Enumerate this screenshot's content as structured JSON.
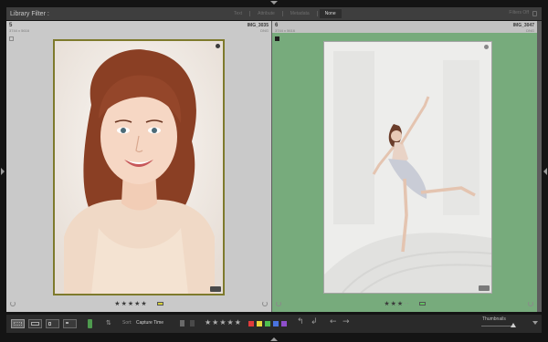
{
  "filter_bar": {
    "title": "Library Filter :",
    "tabs": [
      {
        "label": "Text",
        "active": false
      },
      {
        "label": "Attribute",
        "active": false
      },
      {
        "label": "Metadata",
        "active": false
      },
      {
        "label": "None",
        "active": true
      }
    ],
    "state": "Filters Off"
  },
  "cells": [
    {
      "index": "5",
      "dims": "3744 x 5616",
      "name": "IMG_3035",
      "ext": "DNG",
      "stars": 5,
      "label_color": "#d7d13a",
      "picked": false,
      "selected": true,
      "color_label_bg": "#c9c9c9"
    },
    {
      "index": "6",
      "dims": "3744 x 5616",
      "name": "IMG_3047",
      "ext": "DNG",
      "stars": 3,
      "label_color": "#63c463",
      "picked": true,
      "selected": false,
      "color_label_bg": "#77ab7c"
    }
  ],
  "toolbar": {
    "sort_label": "Sort:",
    "sort_value": "Capture Time",
    "stars_display": "★★★★★",
    "color_labels": [
      "#e03b3b",
      "#e8d53a",
      "#4fbf4f",
      "#4a74e0",
      "#8f4fcc"
    ],
    "thumbnails_label": "Thumbnails",
    "thumbnail_size_fraction": 0.97
  }
}
